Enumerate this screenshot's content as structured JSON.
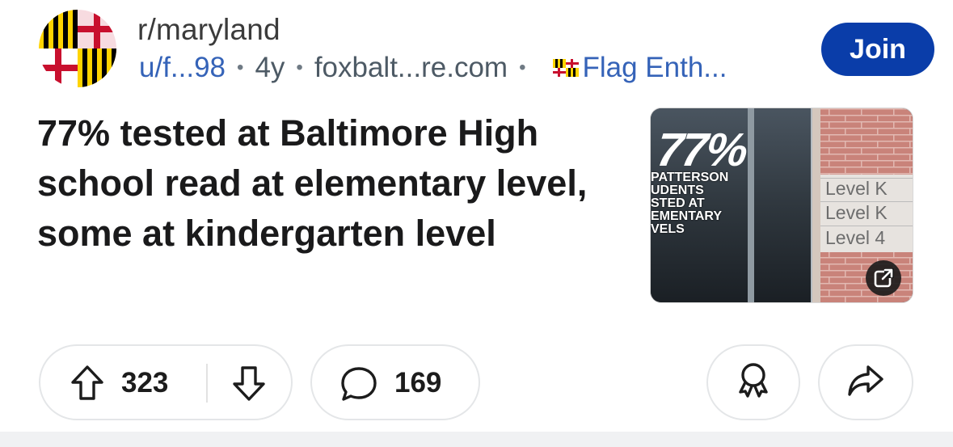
{
  "post": {
    "subreddit": "r/maryland",
    "author": "u/f...98",
    "age": "4y",
    "domain": "foxbalt...re.com",
    "flair": "Flag Enth...",
    "separator": "•",
    "join_label": "Join",
    "title": "77% tested at Baltimore High school read at elementary level, some at kindergarten level"
  },
  "thumbnail": {
    "headline": "77%",
    "caption": "PATTERSON\nUDENTS\nSTED AT\nEMENTARY\nVELS",
    "levels": [
      "Level K",
      "Level K",
      "Level 4"
    ]
  },
  "actions": {
    "upvotes": "323",
    "comments": "169"
  },
  "colors": {
    "accent": "#0a3da9",
    "link": "#3563b8"
  },
  "icons": [
    "maryland-flag-avatar",
    "maryland-flag-flair",
    "upvote-arrow",
    "downvote-arrow",
    "comment-bubble",
    "award-ribbon",
    "share-arrow",
    "external-link"
  ]
}
